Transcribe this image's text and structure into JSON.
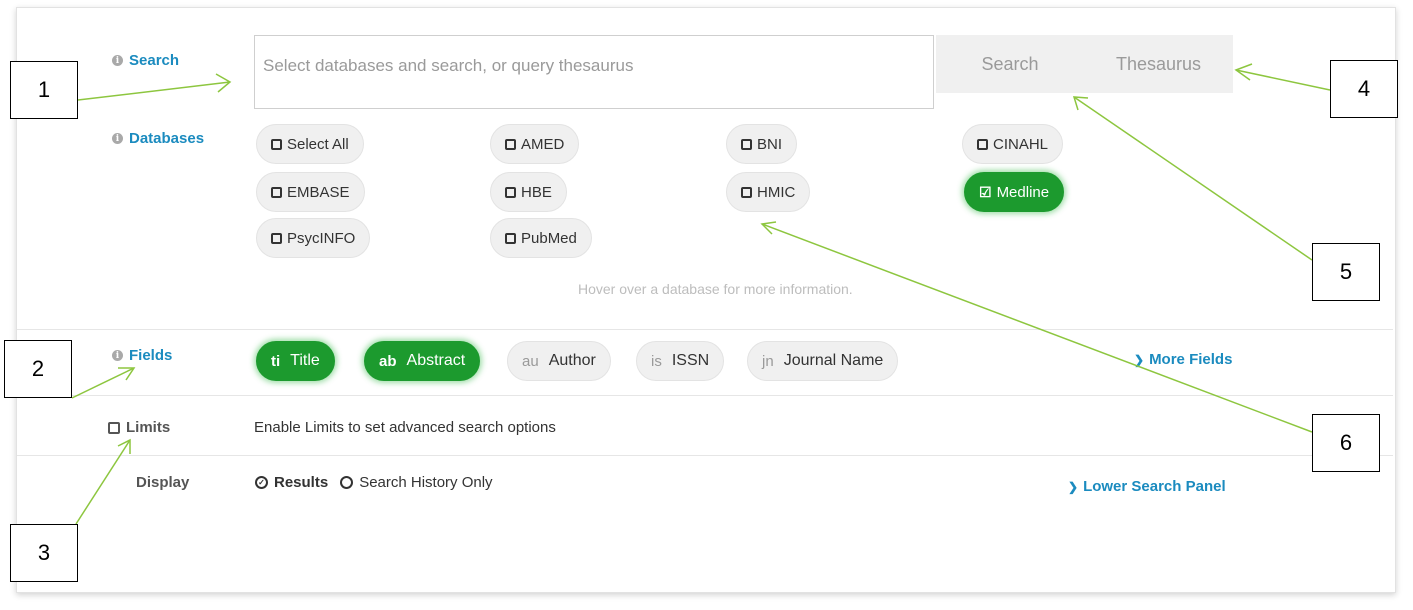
{
  "search": {
    "label": "Search",
    "placeholder": "Select databases and search, or query thesaurus",
    "search_button": "Search",
    "thesaurus_button": "Thesaurus"
  },
  "databases": {
    "label": "Databases",
    "items": [
      {
        "label": "Select All",
        "checked": false
      },
      {
        "label": "AMED",
        "checked": false
      },
      {
        "label": "BNI",
        "checked": false
      },
      {
        "label": "CINAHL",
        "checked": false
      },
      {
        "label": "EMBASE",
        "checked": false
      },
      {
        "label": "HBE",
        "checked": false
      },
      {
        "label": "HMIC",
        "checked": false
      },
      {
        "label": "Medline",
        "checked": true
      },
      {
        "label": "PsycINFO",
        "checked": false
      },
      {
        "label": "PubMed",
        "checked": false
      }
    ],
    "hint": "Hover over a database for more information."
  },
  "fields": {
    "label": "Fields",
    "items": [
      {
        "code": "ti",
        "label": "Title",
        "active": true
      },
      {
        "code": "ab",
        "label": "Abstract",
        "active": true
      },
      {
        "code": "au",
        "label": "Author",
        "active": false
      },
      {
        "code": "is",
        "label": "ISSN",
        "active": false
      },
      {
        "code": "jn",
        "label": "Journal Name",
        "active": false
      }
    ],
    "more": "More Fields"
  },
  "limits": {
    "label": "Limits",
    "description": "Enable Limits to set advanced search options"
  },
  "display": {
    "label": "Display",
    "options": [
      "Results",
      "Search History Only"
    ],
    "selected": "Results",
    "lower_panel": "Lower Search Panel"
  },
  "callouts": [
    "1",
    "2",
    "3",
    "4",
    "5",
    "6"
  ],
  "colors": {
    "accent_blue": "#1b8bbf",
    "active_green": "#1c9a2e",
    "arrow_green": "#8dc63f"
  }
}
